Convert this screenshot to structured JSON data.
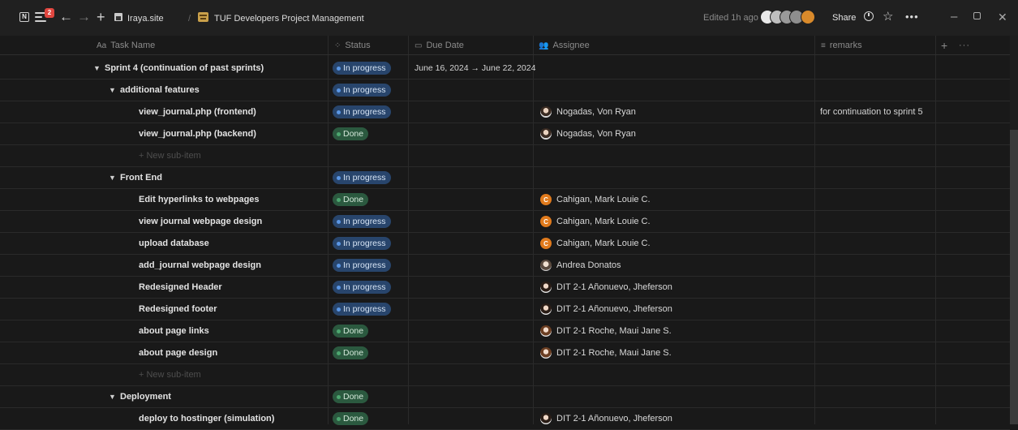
{
  "titlebar": {
    "app_icon": "N",
    "notification_count": "2",
    "nav_back": "←",
    "nav_forward": "→",
    "new_page": "+",
    "workspace": "Iraya.site",
    "separator": "/",
    "page_title": "TUF Developers Project Management",
    "edited": "Edited 1h ago",
    "share": "Share",
    "star": "☆",
    "more": "•••",
    "minimize": "–",
    "close": "✕"
  },
  "columns": {
    "task": "Task Name",
    "task_icon": "Aa",
    "status": "Status",
    "due": "Due Date",
    "assignee": "Assignee",
    "remarks": "remarks",
    "add": "+",
    "more": "···"
  },
  "colors": {
    "in_progress": "#28456c",
    "done": "#2b593f",
    "background": "#191919"
  },
  "rows": [
    {
      "task": "Sprint 4 (continuation of past sprints)",
      "level": 0,
      "caret": "▼",
      "status": "In progress",
      "kind": "prog",
      "due": "June 16, 2024 → June 22, 2024",
      "assignee": "",
      "avatar": "",
      "remarks": ""
    },
    {
      "task": "additional features",
      "level": 1,
      "caret": "▼",
      "status": "In progress",
      "kind": "prog",
      "due": "",
      "assignee": "",
      "avatar": "",
      "remarks": ""
    },
    {
      "task": "view_journal.php (frontend)",
      "level": 2,
      "caret": "",
      "status": "In progress",
      "kind": "prog",
      "due": "",
      "assignee": "Nogadas, Von Ryan",
      "avatar": "photo",
      "remarks": "for continuation to sprint 5"
    },
    {
      "task": "view_journal.php (backend)",
      "level": 2,
      "caret": "",
      "status": "Done",
      "kind": "done",
      "due": "",
      "assignee": "Nogadas, Von Ryan",
      "avatar": "photo",
      "remarks": ""
    },
    {
      "task": "+ New sub-item",
      "level": "new",
      "caret": "",
      "status": "",
      "kind": "",
      "due": "",
      "assignee": "",
      "avatar": "",
      "remarks": ""
    },
    {
      "task": "Front End",
      "level": 1,
      "caret": "▼",
      "status": "In progress",
      "kind": "prog",
      "due": "",
      "assignee": "",
      "avatar": "",
      "remarks": ""
    },
    {
      "task": "Edit hyperlinks to webpages",
      "level": 2,
      "caret": "",
      "status": "Done",
      "kind": "done",
      "due": "",
      "assignee": "Cahigan, Mark Louie C.",
      "avatar": "C",
      "remarks": ""
    },
    {
      "task": "view journal webpage design",
      "level": 2,
      "caret": "",
      "status": "In progress",
      "kind": "prog",
      "due": "",
      "assignee": "Cahigan, Mark Louie C.",
      "avatar": "C",
      "remarks": ""
    },
    {
      "task": "upload database",
      "level": 2,
      "caret": "",
      "status": "In progress",
      "kind": "prog",
      "due": "",
      "assignee": "Cahigan, Mark Louie C.",
      "avatar": "C",
      "remarks": ""
    },
    {
      "task": "add_journal webpage design",
      "level": 2,
      "caret": "",
      "status": "In progress",
      "kind": "prog",
      "due": "",
      "assignee": "Andrea Donatos",
      "avatar": "photo2",
      "remarks": ""
    },
    {
      "task": "Redesigned Header",
      "level": 2,
      "caret": "",
      "status": "In progress",
      "kind": "prog",
      "due": "",
      "assignee": "DIT 2-1 Añonuevo, Jheferson",
      "avatar": "photo3",
      "remarks": ""
    },
    {
      "task": "Redesigned footer",
      "level": 2,
      "caret": "",
      "status": "In progress",
      "kind": "prog",
      "due": "",
      "assignee": "DIT 2-1 Añonuevo, Jheferson",
      "avatar": "photo3",
      "remarks": ""
    },
    {
      "task": "about page links",
      "level": 2,
      "caret": "",
      "status": "Done",
      "kind": "done",
      "due": "",
      "assignee": "DIT 2-1 Roche, Maui Jane S.",
      "avatar": "photo4",
      "remarks": ""
    },
    {
      "task": "about page design",
      "level": 2,
      "caret": "",
      "status": "Done",
      "kind": "done",
      "due": "",
      "assignee": "DIT 2-1 Roche, Maui Jane S.",
      "avatar": "photo4",
      "remarks": ""
    },
    {
      "task": "+ New sub-item",
      "level": "new",
      "caret": "",
      "status": "",
      "kind": "",
      "due": "",
      "assignee": "",
      "avatar": "",
      "remarks": ""
    },
    {
      "task": "Deployment",
      "level": 1,
      "caret": "▼",
      "status": "Done",
      "kind": "done",
      "due": "",
      "assignee": "",
      "avatar": "",
      "remarks": ""
    },
    {
      "task": "deploy to hostinger (simulation)",
      "level": 2,
      "caret": "",
      "status": "Done",
      "kind": "done",
      "due": "",
      "assignee": "DIT 2-1 Añonuevo, Jheferson",
      "avatar": "photo3",
      "remarks": ""
    }
  ]
}
